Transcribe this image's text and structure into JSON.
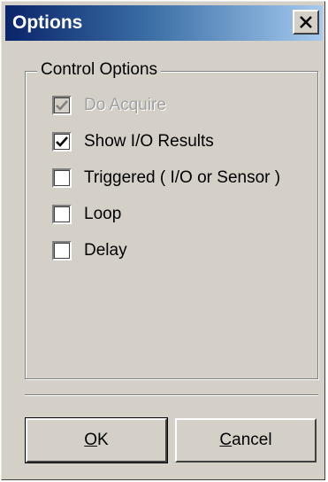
{
  "window": {
    "title": "Options",
    "close_symbol": "✕"
  },
  "group": {
    "label": "Control Options"
  },
  "options": [
    {
      "label": "Do Acquire",
      "checked": true,
      "enabled": false
    },
    {
      "label": "Show I/O Results",
      "checked": true,
      "enabled": true
    },
    {
      "label": "Triggered ( I/O or Sensor )",
      "checked": false,
      "enabled": true
    },
    {
      "label": "Loop",
      "checked": false,
      "enabled": true
    },
    {
      "label": "Delay",
      "checked": false,
      "enabled": true
    }
  ],
  "buttons": {
    "ok_label": "OK",
    "cancel_label": "Cancel"
  },
  "icons": {
    "close": "close-icon",
    "check": "checkmark-icon"
  },
  "colors": {
    "titlebar_start": "#0a246a",
    "titlebar_end": "#a6caf0",
    "face": "#d4d0c8"
  }
}
